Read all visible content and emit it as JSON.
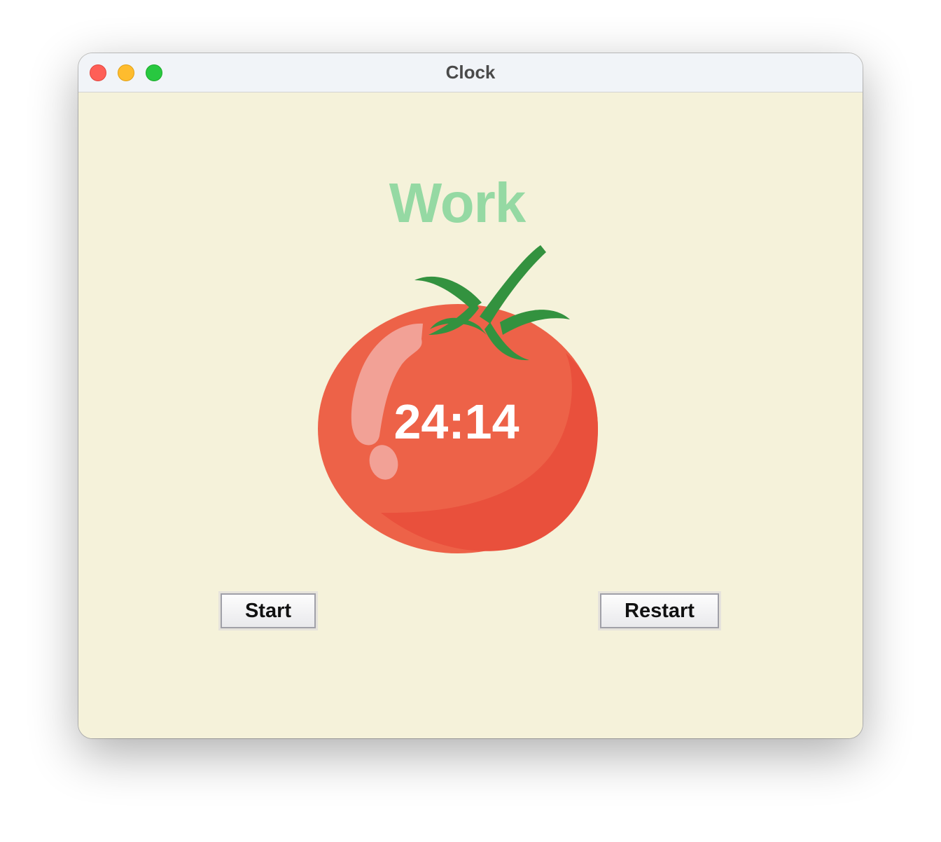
{
  "window": {
    "title": "Clock"
  },
  "app": {
    "mode_label": "Work",
    "timer_text": "24:14",
    "start_label": "Start",
    "restart_label": "Restart"
  },
  "icons": {
    "tomato": "tomato-icon"
  },
  "colors": {
    "background": "#f5f2da",
    "mode_label": "#95d9a3",
    "tomato": "#ed6248",
    "leaves": "#33923f",
    "timer_text": "#ffffff"
  }
}
